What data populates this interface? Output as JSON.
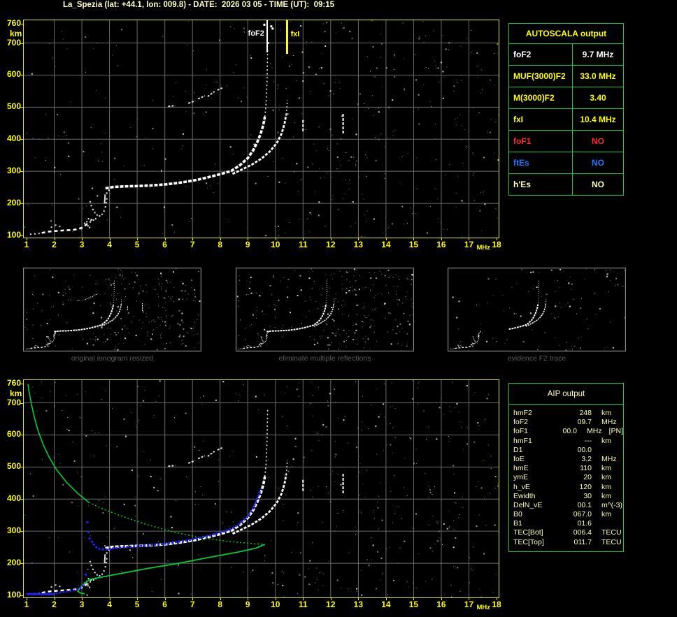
{
  "header": {
    "title": "La_Spezia (lat: +44.1, lon: 009.8) - DATE:  2026 03 05 - TIME (UT):  09:15"
  },
  "colors": {
    "axis": "#ffff00",
    "frame": "#e8e800",
    "grid": "#6b6b6b",
    "green": "#00cc33",
    "blue": "#2020ff",
    "table_border": "#00cc44",
    "pale": "#ffffb8",
    "red": "#ff2a2a",
    "blue_text": "#2277ff",
    "white": "#ffffff",
    "caption": "#5c5c5c"
  },
  "axes": {
    "x_ticks": [
      1,
      2,
      3,
      4,
      5,
      6,
      7,
      8,
      9,
      10,
      11,
      12,
      13,
      14,
      15,
      16,
      17,
      18
    ],
    "x_unit": "MHz",
    "y_ticks": [
      760,
      700,
      600,
      500,
      400,
      300,
      200,
      100
    ],
    "y_unit": "km",
    "x_range": [
      1,
      18
    ],
    "y_range": [
      100,
      760
    ]
  },
  "markers": {
    "foF2": {
      "label": "foF2",
      "freq": 9.7,
      "color": "#ffffff"
    },
    "fxI": {
      "label": "fxI",
      "freq": 10.4,
      "color": "#ffff00"
    }
  },
  "autoscala": {
    "title": "AUTOSCALA output",
    "rows": [
      {
        "label": "foF2",
        "value": "9.7 MHz",
        "color": "#ffffff"
      },
      {
        "label": "MUF(3000)F2",
        "value": "33.0 MHz",
        "color": "#ffff00"
      },
      {
        "label": "M(3000)F2",
        "value": "3.40",
        "color": "#ffff00"
      },
      {
        "label": "fxI",
        "value": "10.4 MHz",
        "color": "#ffff00"
      },
      {
        "label": "foF1",
        "value": "NO",
        "color": "#ff2a2a"
      },
      {
        "label": "ftEs",
        "value": "NO",
        "color": "#2277ff"
      },
      {
        "label": "h'Es",
        "value": "NO",
        "color": "#ffffb8"
      }
    ]
  },
  "aip": {
    "title": "AIP output",
    "rows": [
      {
        "label": "hmF2",
        "value": "248",
        "unit": "km",
        "note": ""
      },
      {
        "label": "foF2",
        "value": "09.7",
        "unit": "MHz",
        "note": ""
      },
      {
        "label": "foF1",
        "value": "00.0",
        "unit": "MHz",
        "note": "[PN]"
      },
      {
        "label": "hmF1",
        "value": "---",
        "unit": "km",
        "note": ""
      },
      {
        "label": "D1",
        "value": "00.0",
        "unit": "",
        "note": ""
      },
      {
        "label": "foE",
        "value": "3.2",
        "unit": "MHz",
        "note": ""
      },
      {
        "label": "hmE",
        "value": "110",
        "unit": "km",
        "note": ""
      },
      {
        "label": "ymE",
        "value": "20",
        "unit": "km",
        "note": ""
      },
      {
        "label": "h_vE",
        "value": "120",
        "unit": "km",
        "note": ""
      },
      {
        "label": "Ewidth",
        "value": "30",
        "unit": "km",
        "note": ""
      },
      {
        "label": "DelN_vE",
        "value": "00.1",
        "unit": "m^(-3)",
        "note": ""
      },
      {
        "label": "B0",
        "value": "067.0",
        "unit": "km",
        "note": ""
      },
      {
        "label": "B1",
        "value": "01.6",
        "unit": "",
        "note": ""
      },
      {
        "label": "TEC[Bot]",
        "value": "006.4",
        "unit": "TECU",
        "note": ""
      },
      {
        "label": "TEC[Top]",
        "value": "011.7",
        "unit": "TECU",
        "note": ""
      }
    ]
  },
  "thumbnails": [
    {
      "caption": "original ionogram resized"
    },
    {
      "caption": "eliminate multiple reflections"
    },
    {
      "caption": "evidence F2 trace"
    }
  ],
  "chart_data": {
    "type": "scatter",
    "title": "Ionogram with autoscaled traces (virtual height km vs frequency MHz)",
    "xlabel": "MHz",
    "ylabel": "km",
    "xlim": [
      1,
      18
    ],
    "ylim": [
      100,
      760
    ],
    "grid": true,
    "scaled_values": {
      "foF2_MHz": 9.7,
      "fxI_MHz": 10.4,
      "hmF2_km": 248
    },
    "traces": {
      "o_trace": [
        [
          3.85,
          247
        ],
        [
          4.1,
          251
        ],
        [
          4.5,
          253
        ],
        [
          5.0,
          254
        ],
        [
          5.5,
          256
        ],
        [
          6.0,
          259
        ],
        [
          6.4,
          263
        ],
        [
          6.8,
          268
        ],
        [
          7.2,
          274
        ],
        [
          7.6,
          282
        ],
        [
          8.0,
          291
        ],
        [
          8.4,
          301
        ],
        [
          8.7,
          318
        ],
        [
          9.0,
          341
        ],
        [
          9.2,
          366
        ],
        [
          9.35,
          392
        ],
        [
          9.47,
          418
        ],
        [
          9.56,
          444
        ],
        [
          9.62,
          470
        ]
      ],
      "o_faint": [
        [
          9.62,
          470
        ],
        [
          9.66,
          505
        ],
        [
          9.68,
          545
        ],
        [
          9.7,
          590
        ],
        [
          9.71,
          635
        ],
        [
          9.72,
          678
        ]
      ],
      "x_trace": [
        [
          8.45,
          292
        ],
        [
          8.8,
          306
        ],
        [
          9.15,
          321
        ],
        [
          9.5,
          340
        ],
        [
          9.8,
          362
        ],
        [
          10.05,
          388
        ],
        [
          10.22,
          417
        ],
        [
          10.33,
          448
        ],
        [
          10.39,
          477
        ]
      ],
      "x_faint": [
        [
          10.39,
          477
        ],
        [
          10.42,
          505
        ],
        [
          10.43,
          522
        ]
      ],
      "es_white": [
        [
          1.55,
          108
        ],
        [
          1.8,
          112
        ],
        [
          2.05,
          114
        ],
        [
          2.35,
          116
        ],
        [
          2.6,
          117
        ],
        [
          2.8,
          119
        ],
        [
          3.0,
          124
        ],
        [
          3.1,
          130
        ],
        [
          3.2,
          137
        ]
      ],
      "es_scatter": [
        [
          1.15,
          104
        ],
        [
          1.3,
          105
        ],
        [
          1.45,
          106
        ],
        [
          1.9,
          126
        ],
        [
          2.05,
          132
        ],
        [
          2.2,
          128
        ],
        [
          3.3,
          142
        ],
        [
          3.35,
          150
        ]
      ],
      "cusp": [
        [
          3.3,
          205
        ],
        [
          3.34,
          193
        ],
        [
          3.4,
          181
        ],
        [
          3.47,
          171
        ],
        [
          3.55,
          164
        ],
        [
          3.64,
          161
        ],
        [
          3.73,
          166
        ],
        [
          3.8,
          176
        ],
        [
          3.85,
          189
        ],
        [
          3.88,
          202
        ],
        [
          3.9,
          214
        ],
        [
          3.5,
          152
        ],
        [
          3.42,
          148
        ],
        [
          3.33,
          147
        ],
        [
          3.24,
          152
        ],
        [
          3.18,
          143
        ],
        [
          3.1,
          138
        ],
        [
          3.22,
          130
        ],
        [
          3.28,
          125
        ]
      ],
      "cusp_streak": [
        [
          3.82,
          200
        ],
        [
          3.84,
          228
        ]
      ],
      "pre_trace": [
        [
          3.9,
          232
        ],
        [
          3.98,
          241
        ],
        [
          4.05,
          248
        ]
      ],
      "second_hop": [
        [
          [
            6.12,
            502
          ],
          [
            6.38,
            505
          ]
        ],
        [
          [
            6.85,
            512
          ],
          [
            7.1,
            520
          ]
        ],
        [
          [
            7.2,
            526
          ],
          [
            7.45,
            535
          ]
        ],
        [
          [
            7.55,
            533
          ],
          [
            7.8,
            549
          ]
        ],
        [
          [
            7.9,
            553
          ],
          [
            8.08,
            560
          ]
        ]
      ],
      "streaks": [
        [
          [
            12.45,
            418
          ],
          [
            12.45,
            482
          ]
        ],
        [
          [
            11.0,
            425
          ],
          [
            11.0,
            460
          ]
        ]
      ],
      "top_blobs": [
        [
          9.85,
          752
        ],
        [
          9.9,
          745
        ],
        [
          9.6,
          757
        ],
        [
          9.73,
          700
        ]
      ],
      "green_upper": [
        [
          1.05,
          758
        ],
        [
          1.1,
          730
        ],
        [
          1.18,
          695
        ],
        [
          1.28,
          655
        ],
        [
          1.42,
          612
        ],
        [
          1.6,
          570
        ],
        [
          1.82,
          530
        ],
        [
          2.1,
          490
        ],
        [
          2.45,
          452
        ],
        [
          2.85,
          418
        ],
        [
          3.25,
          390
        ]
      ],
      "green_dotted": [
        [
          3.25,
          390
        ],
        [
          3.8,
          368
        ],
        [
          4.5,
          345
        ],
        [
          5.3,
          322
        ],
        [
          6.2,
          300
        ],
        [
          7.2,
          281
        ],
        [
          8.3,
          268
        ],
        [
          9.2,
          261
        ],
        [
          9.62,
          259
        ]
      ],
      "green_lower": [
        [
          9.62,
          259
        ],
        [
          9.3,
          247
        ],
        [
          8.6,
          234
        ],
        [
          7.6,
          218
        ],
        [
          6.5,
          200
        ],
        [
          5.4,
          184
        ],
        [
          4.4,
          168
        ],
        [
          3.6,
          155
        ],
        [
          3.3,
          150
        ],
        [
          3.1,
          137
        ],
        [
          2.92,
          122
        ],
        [
          2.85,
          113
        ],
        [
          2.95,
          107
        ],
        [
          3.1,
          105
        ]
      ],
      "blue_main": [
        [
          3.35,
          270
        ],
        [
          3.42,
          260
        ],
        [
          3.52,
          250
        ],
        [
          3.65,
          244
        ],
        [
          3.85,
          243
        ],
        [
          4.1,
          246
        ],
        [
          4.5,
          250
        ],
        [
          5.0,
          253
        ],
        [
          5.5,
          257
        ],
        [
          6.0,
          261
        ],
        [
          6.4,
          266
        ],
        [
          6.8,
          271
        ],
        [
          7.2,
          278
        ],
        [
          7.6,
          286
        ],
        [
          8.0,
          296
        ],
        [
          8.4,
          307
        ],
        [
          8.7,
          323
        ],
        [
          9.0,
          346
        ],
        [
          9.2,
          372
        ],
        [
          9.33,
          398
        ],
        [
          9.42,
          420
        ],
        [
          9.48,
          432
        ]
      ],
      "blue_iso": [
        [
          3.2,
          328
        ],
        [
          3.24,
          297
        ],
        [
          3.28,
          277
        ],
        [
          3.14,
          165
        ]
      ],
      "blue_es_flat": [
        [
          1.0,
          104
        ],
        [
          2.0,
          104
        ]
      ],
      "blue_es_rise": [
        [
          2.05,
          106
        ],
        [
          2.3,
          110
        ],
        [
          2.55,
          113
        ],
        [
          2.75,
          116
        ],
        [
          2.92,
          121
        ],
        [
          3.02,
          127
        ],
        [
          3.06,
          134
        ]
      ]
    }
  }
}
